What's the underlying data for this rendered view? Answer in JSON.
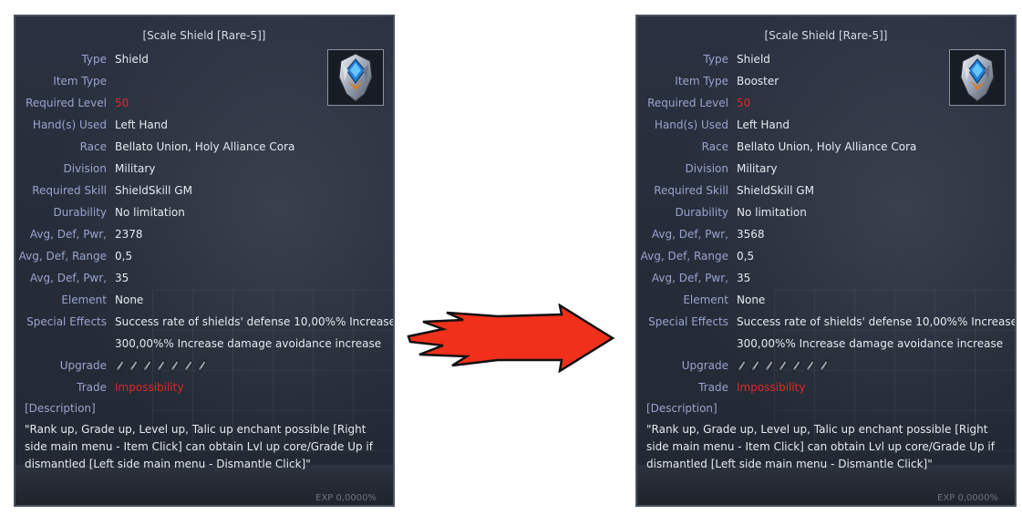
{
  "left_card": {
    "title": "[Scale Shield [Rare-5]]",
    "icon": "shield-item-icon",
    "rows": [
      {
        "label": "Type",
        "value": "Shield"
      },
      {
        "label": "Item Type",
        "value": ""
      },
      {
        "label": "Required Level",
        "value": "50"
      },
      {
        "label": "Hand(s) Used",
        "value": "Left Hand"
      },
      {
        "label": "Race",
        "value": "Bellato Union, Holy Alliance Cora"
      },
      {
        "label": "Division",
        "value": "Military"
      },
      {
        "label": "Required Skill",
        "value": "ShieldSkill GM"
      },
      {
        "label": "Durability",
        "value": "No limitation"
      },
      {
        "label": "Avg, Def, Pwr,",
        "value": "2378"
      },
      {
        "label": "Avg, Def, Range",
        "value": "0,5"
      },
      {
        "label": "Avg, Def, Pwr,",
        "value": "35"
      },
      {
        "label": "Element",
        "value": "None"
      },
      {
        "label": "Special Effects",
        "value": "Success rate of shields' defense 10,00%% Increase"
      },
      {
        "label": "",
        "value": "300,00%% Increase damage avoidance increase"
      },
      {
        "label": "Upgrade",
        "value": ""
      },
      {
        "label": "Trade",
        "value": "Impossibility"
      }
    ],
    "description_header": "[Description]",
    "description": "\"Rank up, Grade up, Level up, Talic up enchant possible [Right side main menu - Item Click] can obtain Lvl up core/Grade Up if dismantled [Left side main menu - Dismantle Click]\"",
    "exp": "EXP 0,0000%"
  },
  "right_card": {
    "title": "[Scale Shield [Rare-5]]",
    "icon": "shield-item-icon",
    "rows": [
      {
        "label": "Type",
        "value": "Shield"
      },
      {
        "label": "Item Type",
        "value": "Booster"
      },
      {
        "label": "Required Level",
        "value": "50"
      },
      {
        "label": "Hand(s) Used",
        "value": "Left Hand"
      },
      {
        "label": "Race",
        "value": "Bellato Union, Holy Alliance Cora"
      },
      {
        "label": "Division",
        "value": "Military"
      },
      {
        "label": "Required Skill",
        "value": "ShieldSkill GM"
      },
      {
        "label": "Durability",
        "value": "No limitation"
      },
      {
        "label": "Avg, Def, Pwr,",
        "value": "3568"
      },
      {
        "label": "Avg, Def, Range",
        "value": "0,5"
      },
      {
        "label": "Avg, Def, Pwr,",
        "value": "35"
      },
      {
        "label": "Element",
        "value": "None"
      },
      {
        "label": "Special Effects",
        "value": "Success rate of shields' defense 10,00%% Increase"
      },
      {
        "label": "",
        "value": "300,00%% Increase damage avoidance increase"
      },
      {
        "label": "Upgrade",
        "value": ""
      },
      {
        "label": "Trade",
        "value": "Impossibility"
      }
    ],
    "description_header": "[Description]",
    "description": "\"Rank up, Grade up, Level up, Talic up enchant possible [Right side main menu - Item Click] can obtain Lvl up core/Grade Up if dismantled [Left side main menu - Dismantle Click]\"",
    "exp": "EXP 0,0000%"
  },
  "upgrade_slots": 7,
  "colors": {
    "label": "#9aa3ce",
    "value": "#e6e9ef",
    "warning": "#e0282a",
    "arrow_fill": "#f0301a",
    "arrow_stroke": "#111111"
  },
  "arrow_icon": "right-arrow-icon"
}
